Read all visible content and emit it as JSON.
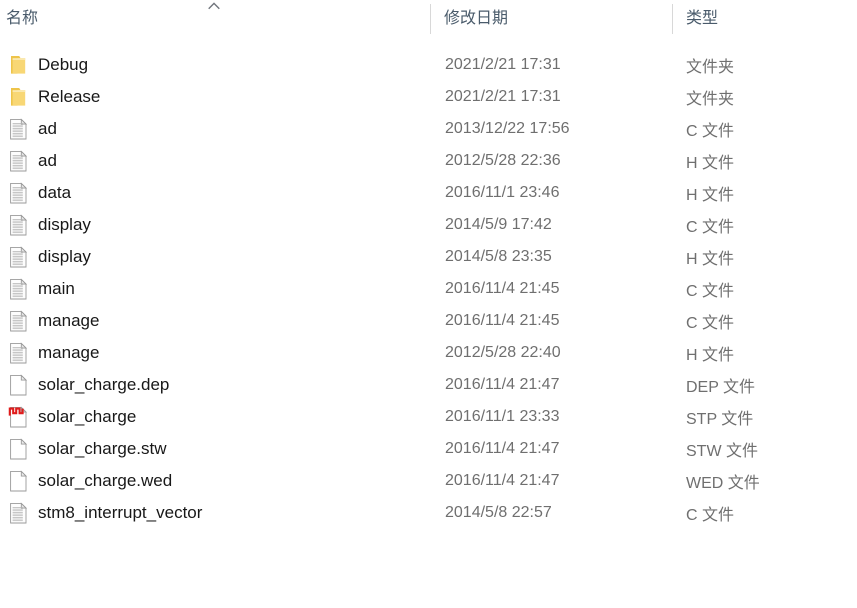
{
  "view": {
    "name": "file-explorer-details-list",
    "sort_column": "名称",
    "sort_direction": "ascending",
    "sort_indicator_glyph": "chevron-up"
  },
  "columns": {
    "name": "名称",
    "date_modified": "修改日期",
    "type": "类型"
  },
  "colors": {
    "header_text": "#4a5b6b",
    "row_primary_text": "#181818",
    "row_secondary_text": "#6f6f6f",
    "folder_icon": "#f8d775",
    "folder_icon_dark": "#eec44a",
    "document_icon_outline": "#9a9a9a",
    "document_icon_lines": "#b4b4b4",
    "stp_waveform": "#e01b1b",
    "background": "#ffffff",
    "separator": "#d8d8d8"
  },
  "files": [
    {
      "name": "Debug",
      "date": "2021/2/21 17:31",
      "type": "文件夹",
      "icon": "folder-icon"
    },
    {
      "name": "Release",
      "date": "2021/2/21 17:31",
      "type": "文件夹",
      "icon": "folder-icon"
    },
    {
      "name": "ad",
      "date": "2013/12/22 17:56",
      "type": "C 文件",
      "icon": "text-document-icon"
    },
    {
      "name": "ad",
      "date": "2012/5/28 22:36",
      "type": "H 文件",
      "icon": "text-document-icon"
    },
    {
      "name": "data",
      "date": "2016/11/1 23:46",
      "type": "H 文件",
      "icon": "text-document-icon"
    },
    {
      "name": "display",
      "date": "2014/5/9 17:42",
      "type": "C 文件",
      "icon": "text-document-icon"
    },
    {
      "name": "display",
      "date": "2014/5/8 23:35",
      "type": "H 文件",
      "icon": "text-document-icon"
    },
    {
      "name": "main",
      "date": "2016/11/4 21:45",
      "type": "C 文件",
      "icon": "text-document-icon"
    },
    {
      "name": "manage",
      "date": "2016/11/4 21:45",
      "type": "C 文件",
      "icon": "text-document-icon"
    },
    {
      "name": "manage",
      "date": "2012/5/28 22:40",
      "type": "H 文件",
      "icon": "text-document-icon"
    },
    {
      "name": "solar_charge.dep",
      "date": "2016/11/4 21:47",
      "type": "DEP 文件",
      "icon": "blank-document-icon"
    },
    {
      "name": "solar_charge",
      "date": "2016/11/1 23:33",
      "type": "STP 文件",
      "icon": "stp-waveform-document-icon"
    },
    {
      "name": "solar_charge.stw",
      "date": "2016/11/4 21:47",
      "type": "STW 文件",
      "icon": "blank-document-icon"
    },
    {
      "name": "solar_charge.wed",
      "date": "2016/11/4 21:47",
      "type": "WED 文件",
      "icon": "blank-document-icon"
    },
    {
      "name": "stm8_interrupt_vector",
      "date": "2014/5/8 22:57",
      "type": "C 文件",
      "icon": "text-document-icon"
    }
  ]
}
